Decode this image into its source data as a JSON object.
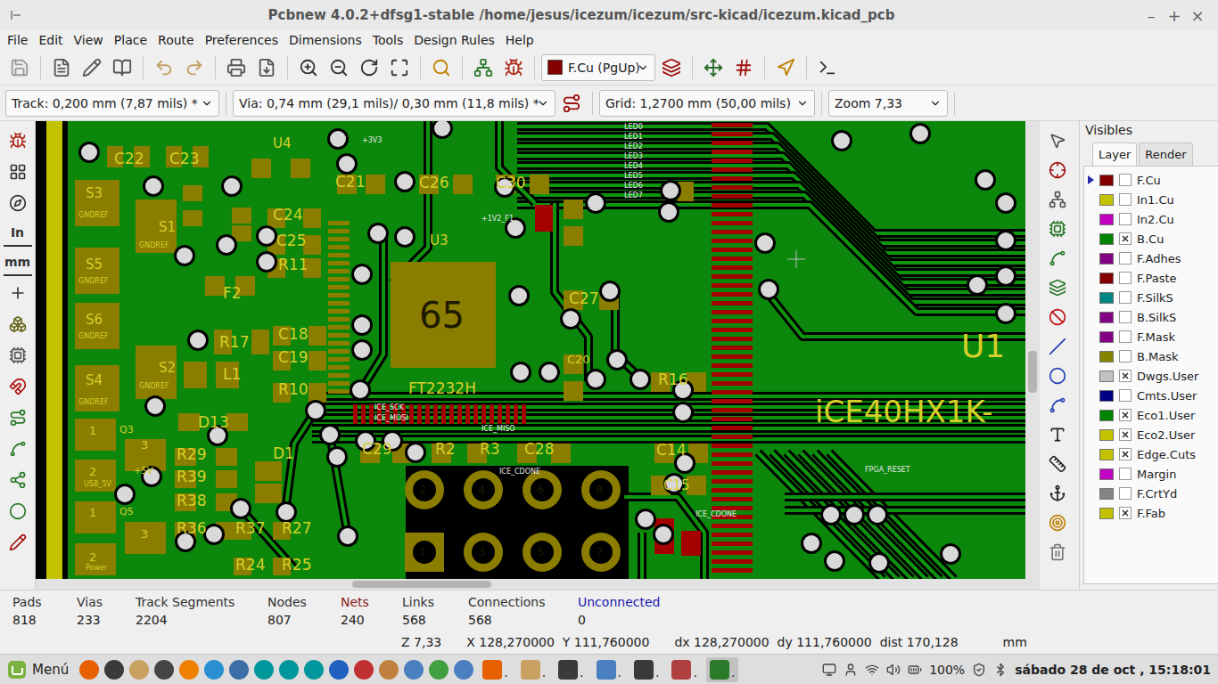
{
  "window": {
    "title": "Pcbnew 4.0.2+dfsg1-stable /home/jesus/icezum/icezum/src-kicad/icezum.kicad_pcb",
    "controls": [
      "–",
      "+",
      "×"
    ]
  },
  "menu": [
    "File",
    "Edit",
    "View",
    "Place",
    "Route",
    "Preferences",
    "Dimensions",
    "Tools",
    "Design Rules",
    "Help"
  ],
  "layer_select": {
    "label": "F.Cu (PgUp)",
    "color": "#840000"
  },
  "options": [
    {
      "label": "Track: 0,200 mm (7,87 mils) *"
    },
    {
      "label": "Via: 0,74 mm (29,1 mils)/ 0,30 mm (11,8 mils) *"
    },
    {
      "label": "Grid: 1,2700 mm (50,00 mils)"
    },
    {
      "label": "Zoom 7,33"
    }
  ],
  "left_toolbar": [
    "In",
    "mm"
  ],
  "board": {
    "labels": [
      "U4",
      "C22",
      "C23",
      "S3",
      "GNDREF",
      "S1",
      "GNDREF",
      "S5",
      "GNDREF",
      "S6",
      "GNDREF",
      "S2",
      "GNDREF",
      "S4",
      "GNDREF",
      "C21",
      "C26",
      "C30",
      "C24",
      "C25",
      "R11",
      "U3",
      "F2",
      "65",
      "R17",
      "C18",
      "C19",
      "R10",
      "L1",
      "FT2232H",
      "C27",
      "C20",
      "R16",
      "U1",
      "iCE40HX1K-",
      "D13",
      "C29",
      "R2",
      "R3",
      "C28",
      "C14",
      "C15",
      "D1",
      "Q3",
      "+5V",
      "R29",
      "R39",
      "R38",
      "R36",
      "R37",
      "R27",
      "R24",
      "R25",
      "Q5",
      "USB_5V",
      "Power",
      "1",
      "2",
      "3",
      "1",
      "2",
      "3",
      "2",
      "4",
      "6",
      "8",
      "1",
      "3",
      "5",
      "7",
      "LED0",
      "LED1",
      "LED2",
      "LED3",
      "LED4",
      "LED5",
      "LED6",
      "LED7",
      "+1V2_F1",
      "+3V3",
      "ICE_SCK",
      "ICE_MOSI",
      "ICE_MISO",
      "ICE_CDONE",
      "FPGA_RESET",
      "ICE_CDONE"
    ],
    "scroll": {
      "horizontal": {
        "level": 0.32,
        "size": 0.14
      },
      "vertical": {
        "level": 0.49,
        "size": 0.09
      }
    }
  },
  "visibles": {
    "title": "Visibles",
    "tabs": [
      {
        "label": "Layer",
        "selected": true
      },
      {
        "label": "Render",
        "selected": false
      }
    ],
    "layers": [
      {
        "name": "F.Cu",
        "color": "#840000",
        "checked": false,
        "selected": true
      },
      {
        "name": "In1.Cu",
        "color": "#c2c200",
        "checked": false,
        "selected": false
      },
      {
        "name": "In2.Cu",
        "color": "#c200c2",
        "checked": false,
        "selected": false
      },
      {
        "name": "B.Cu",
        "color": "#008400",
        "checked": true,
        "selected": false
      },
      {
        "name": "F.Adhes",
        "color": "#840084",
        "checked": false,
        "selected": false
      },
      {
        "name": "F.Paste",
        "color": "#840000",
        "checked": false,
        "selected": false
      },
      {
        "name": "F.SilkS",
        "color": "#008484",
        "checked": false,
        "selected": false
      },
      {
        "name": "B.SilkS",
        "color": "#840084",
        "checked": false,
        "selected": false
      },
      {
        "name": "F.Mask",
        "color": "#840084",
        "checked": false,
        "selected": false
      },
      {
        "name": "B.Mask",
        "color": "#848400",
        "checked": false,
        "selected": false
      },
      {
        "name": "Dwgs.User",
        "color": "#c2c2c2",
        "checked": true,
        "selected": false
      },
      {
        "name": "Cmts.User",
        "color": "#000084",
        "checked": false,
        "selected": false
      },
      {
        "name": "Eco1.User",
        "color": "#008400",
        "checked": true,
        "selected": false
      },
      {
        "name": "Eco2.User",
        "color": "#c2c200",
        "checked": true,
        "selected": false
      },
      {
        "name": "Edge.Cuts",
        "color": "#c2c200",
        "checked": true,
        "selected": false
      },
      {
        "name": "Margin",
        "color": "#c200c2",
        "checked": false,
        "selected": false
      },
      {
        "name": "F.CrtYd",
        "color": "#848484",
        "checked": false,
        "selected": false
      },
      {
        "name": "F.Fab",
        "color": "#c2c200",
        "checked": true,
        "selected": false
      }
    ]
  },
  "status": [
    {
      "label": "Pads",
      "value": "818",
      "color": "#333333"
    },
    {
      "label": "Vias",
      "value": "233",
      "color": "#333333"
    },
    {
      "label": "Track Segments",
      "value": "2204",
      "color": "#333333"
    },
    {
      "label": "Nodes",
      "value": "807",
      "color": "#333333"
    },
    {
      "label": "Nets",
      "value": "240",
      "color": "#8b1a1a"
    },
    {
      "label": "Links",
      "value": "568",
      "color": "#333333"
    },
    {
      "label": "Connections",
      "value": "568",
      "color": "#333333"
    },
    {
      "label": "Unconnected",
      "value": "0",
      "color": "#1a1ab0"
    }
  ],
  "coords": [
    "Z 7,33",
    "X 128,270000  Y 111,760000",
    "dx 128,270000  dy 111,760000  dist 170,128",
    "mm"
  ],
  "taskbar": {
    "menu": "Menú",
    "windows": [
      {
        "title": ".",
        "kind": "browser",
        "selected": false
      },
      {
        "title": ".",
        "kind": "files",
        "selected": false
      },
      {
        "title": ".",
        "kind": "terminal",
        "selected": false
      },
      {
        "title": ".",
        "kind": "document",
        "selected": false
      },
      {
        "title": ".",
        "kind": "terminal",
        "selected": false
      },
      {
        "title": ".",
        "kind": "kicad",
        "selected": false
      },
      {
        "title": ".",
        "kind": "pcbnew",
        "selected": true
      }
    ],
    "battery": "100%",
    "clock": "sábado 28 de oct , 15:18:01"
  }
}
